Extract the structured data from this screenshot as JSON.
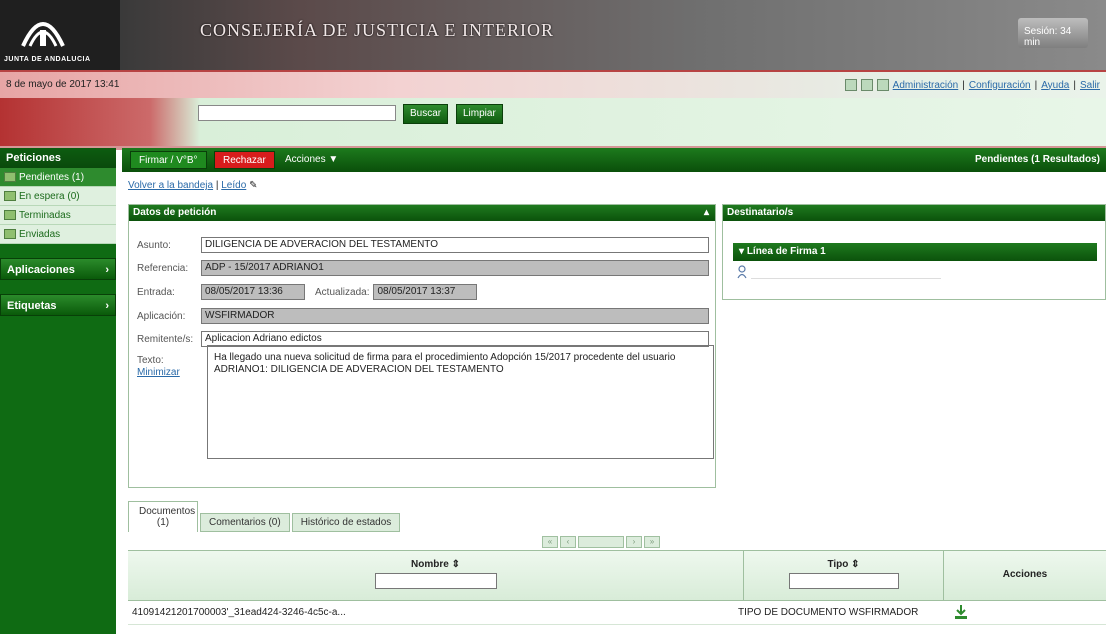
{
  "header": {
    "logo_text": "JUNTA DE ANDALUCIA",
    "app_title": "CONSEJERÍA DE JUSTICIA E INTERIOR",
    "session": "Sesión: 34 min",
    "date": "8 de mayo de 2017 13:41",
    "links": [
      "Administración",
      "Configuración",
      "Ayuda",
      "Salir"
    ]
  },
  "search": {
    "placeholder": "",
    "search_btn": "Buscar",
    "clear_btn": "Limpiar"
  },
  "sidebar": {
    "section": "Peticiones",
    "items": [
      {
        "label": "Pendientes (1)",
        "active": true
      },
      {
        "label": "En espera (0)",
        "active": false
      },
      {
        "label": "Terminadas",
        "active": false
      },
      {
        "label": "Enviadas",
        "active": false
      }
    ],
    "apps": "Aplicaciones",
    "tags": "Etiquetas"
  },
  "toolbar": {
    "sign": "Firmar / V°B°",
    "reject": "Rechazar",
    "actions": "Acciones ▼",
    "status": "Pendientes (1 Resultados)"
  },
  "breadcrumb": {
    "back": "Volver a la bandeja",
    "sep": "|",
    "read": "Leído"
  },
  "request": {
    "title": "Datos de petición",
    "asunto_label": "Asunto:",
    "asunto": "DILIGENCIA DE ADVERACION DEL TESTAMENTO",
    "referencia_label": "Referencia:",
    "referencia": "ADP - 15/2017 ADRIANO1",
    "entrada_label": "Entrada:",
    "entrada": "08/05/2017 13:36",
    "actualizada_label": "Actualizada:",
    "actualizada": "08/05/2017 13:37",
    "aplicacion_label": "Aplicación:",
    "aplicacion": "WSFIRMADOR",
    "remitente_label": "Remitente/s:",
    "remitente": "Aplicacion Adriano  edictos",
    "texto_label": "Texto:",
    "minimize_link": "Minimizar",
    "texto": "Ha llegado una nueva solicitud de firma para el procedimiento Adopción 15/2017 procedente del usuario ADRIANO1: DILIGENCIA DE ADVERACION DEL TESTAMENTO"
  },
  "recipients": {
    "title": "Destinatario/s",
    "firma": "Línea de Firma 1"
  },
  "tabs": {
    "docs": "Documentos (1)",
    "comments": "Comentarios (0)",
    "history": "Histórico de estados"
  },
  "grid": {
    "col_name": "Nombre ⇕",
    "col_type": "Tipo ⇕",
    "col_actions": "Acciones",
    "row_name": "41091421201700003'_31ead424-3246-4c5c-a...",
    "row_type": "TIPO DE DOCUMENTO WSFIRMADOR"
  },
  "colors": {
    "accent_green": "#0f6b13",
    "reject_red": "#d81c1c",
    "link_blue": "#2a6aa8"
  }
}
